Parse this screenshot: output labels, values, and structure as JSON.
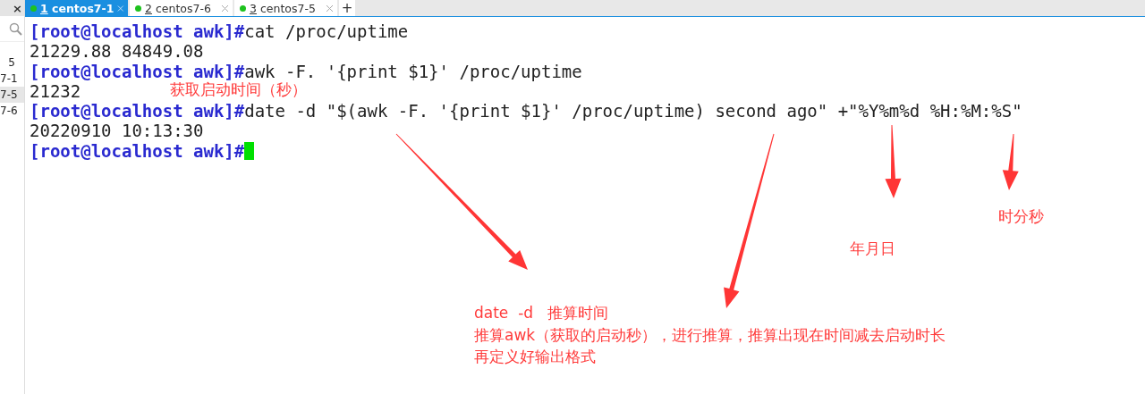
{
  "sidebar": {
    "close": "×",
    "items": [
      {
        "label": "5",
        "selected": false
      },
      {
        "label": "7-1",
        "selected": false
      },
      {
        "label": "7-5",
        "selected": true
      },
      {
        "label": "7-6",
        "selected": false
      }
    ]
  },
  "tabs": [
    {
      "number": "1",
      "name": "centos7-1",
      "selected": true
    },
    {
      "number": "2",
      "name": "centos7-6",
      "selected": false
    },
    {
      "number": "3",
      "name": "centos7-5",
      "selected": false
    }
  ],
  "new_tab": "+",
  "terminal": {
    "lines": [
      {
        "kind": "input",
        "prompt": "[root@localhost awk]#",
        "command": "cat /proc/uptime"
      },
      {
        "kind": "output",
        "text": "21229.88 84849.08"
      },
      {
        "kind": "input",
        "prompt": "[root@localhost awk]#",
        "command": "awk -F. '{print $1}' /proc/uptime"
      },
      {
        "kind": "output",
        "text": "21232"
      },
      {
        "kind": "input",
        "prompt": "[root@localhost awk]#",
        "command": "date -d \"$(awk -F. '{print $1}' /proc/uptime) second ago\" +\"%Y%m%d %H:%M:%S\""
      },
      {
        "kind": "output",
        "text": "20220910 10:13:30"
      },
      {
        "kind": "cursor",
        "prompt": "[root@localhost awk]#"
      }
    ]
  },
  "annotations": [
    {
      "text": "获取启动时间（秒）"
    },
    {
      "text": "时分秒"
    },
    {
      "text": "年月日"
    }
  ],
  "note": {
    "lines": [
      "date  -d   推算时间",
      "推算awk（获取的启动秒），进行推算，推算出现在时间减去启动时长",
      "再定义好输出格式"
    ]
  }
}
